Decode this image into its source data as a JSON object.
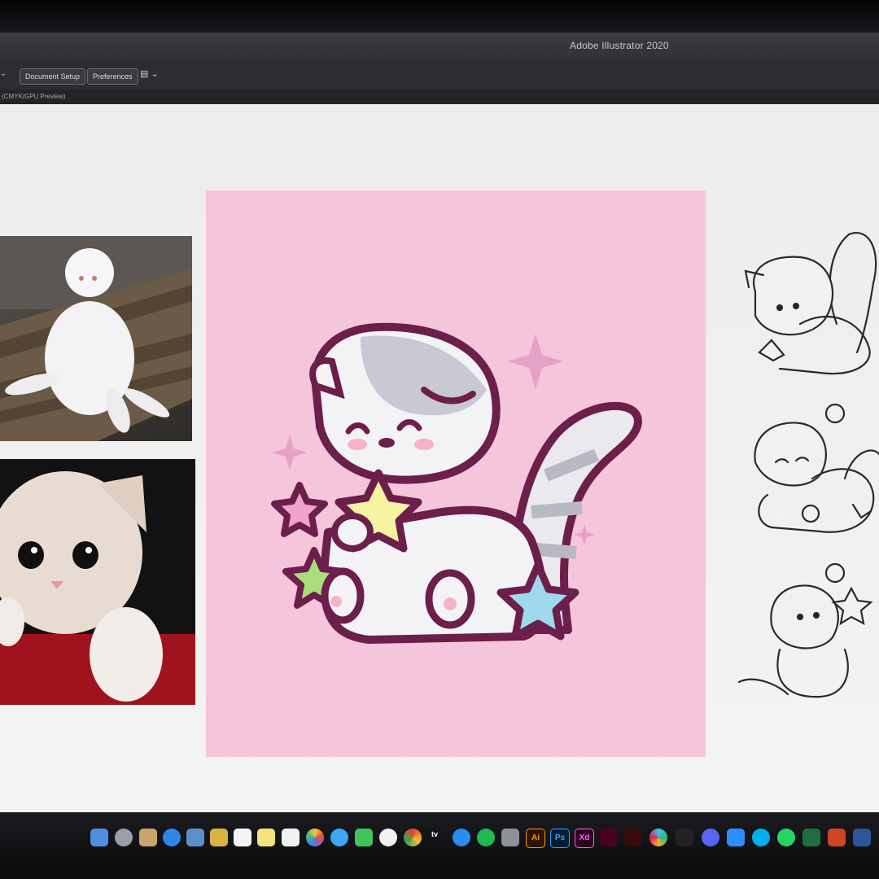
{
  "window": {
    "title": "Adobe Illustrator 2020"
  },
  "control_bar": {
    "document_setup_label": "Document Setup",
    "preferences_label": "Preferences"
  },
  "document_tab": {
    "label": "(CMYK/GPU Preview)"
  },
  "artboard": {
    "background": "#f4c5db",
    "outline_color": "#6b1f4a"
  },
  "dock": {
    "labels": {
      "ai": "Ai",
      "ps": "Ps",
      "xd": "Xd",
      "tv": "tv"
    },
    "icons": [
      "finder-icon",
      "launchpad-icon",
      "app-icon",
      "safari-icon",
      "preview-icon",
      "notes-icon",
      "calendar-icon",
      "stickies-icon",
      "reminders-icon",
      "photos-icon",
      "messages-icon",
      "facetime-icon",
      "music-icon",
      "chrome-icon",
      "tv-icon",
      "appstore-icon",
      "spotify-icon",
      "system-preferences-icon",
      "illustrator-icon",
      "photoshop-icon",
      "xd-icon",
      "indesign-icon",
      "acrobat-icon",
      "slack-icon",
      "app-icon-2",
      "discord-icon",
      "zoom-icon",
      "skype-icon",
      "whatsapp-icon",
      "excel-icon",
      "powerpoint-icon",
      "word-icon"
    ]
  }
}
